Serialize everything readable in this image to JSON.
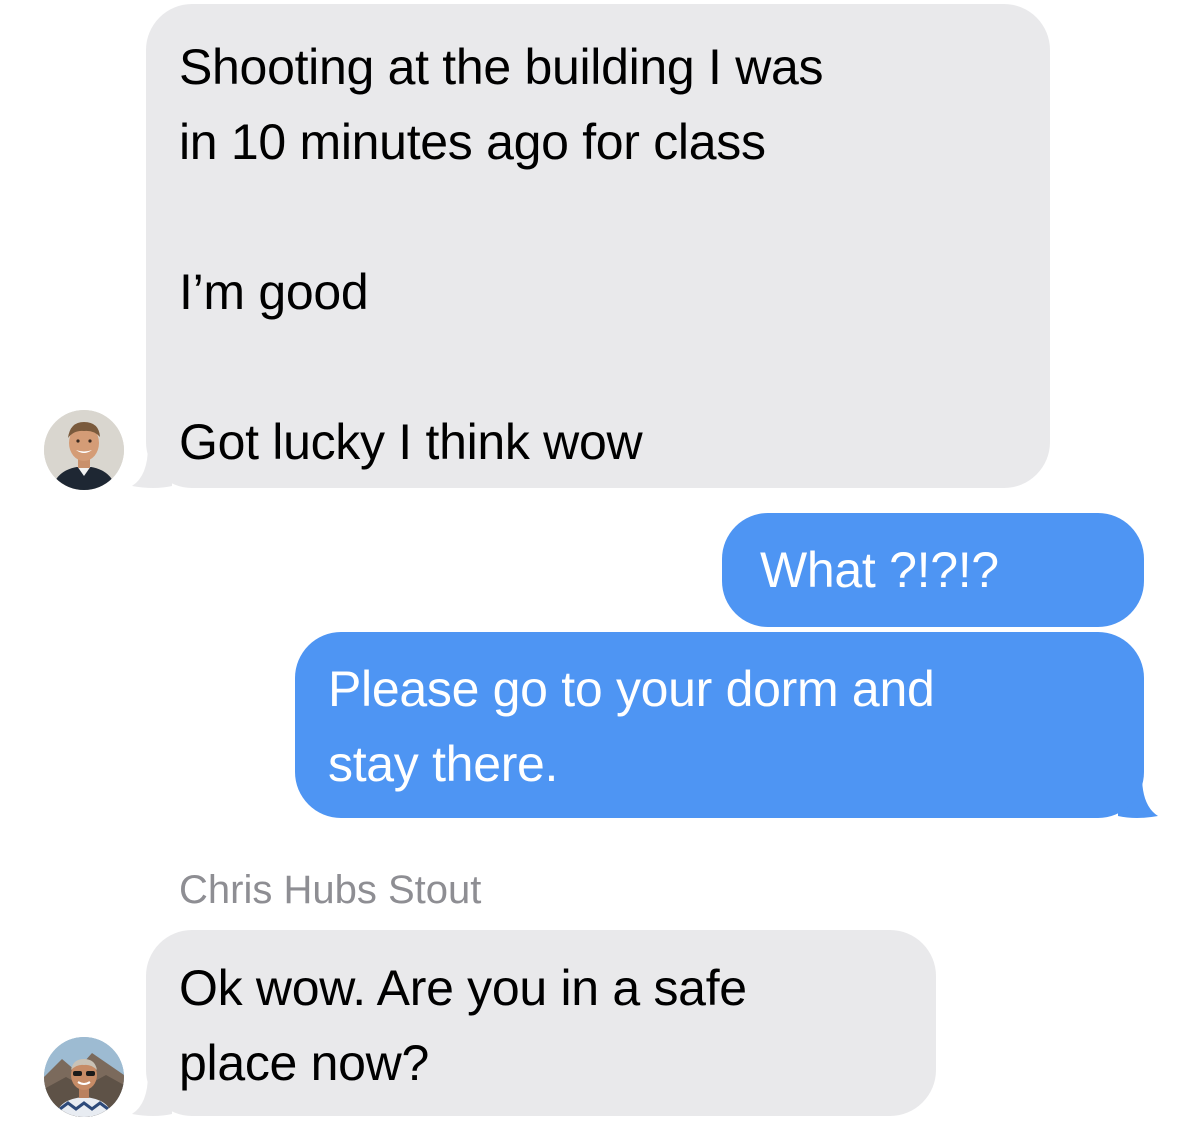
{
  "messages": [
    {
      "direction": "incoming",
      "lines": [
        "Shooting at the building I was",
        "in 10 minutes ago for class",
        "",
        "I’m good",
        "",
        "Got lucky I think wow"
      ]
    },
    {
      "direction": "outgoing",
      "lines": [
        "What ?!?!?"
      ]
    },
    {
      "direction": "outgoing",
      "lines": [
        "Please go to your dorm and",
        "stay there."
      ]
    },
    {
      "direction": "incoming",
      "sender": "Chris Hubs Stout",
      "lines": [
        "Ok wow. Are you in a safe",
        "place now?"
      ]
    }
  ],
  "colors": {
    "incoming_bubble": "#e9e9eb",
    "outgoing_bubble": "#4e95f3",
    "incoming_text": "#000000",
    "outgoing_text": "#ffffff",
    "sender_name": "#8e8e93"
  },
  "avatars": [
    {
      "icon": "contact-photo-smiling-young-man"
    },
    {
      "icon": "contact-photo-man-with-sunglasses-mountains"
    }
  ]
}
